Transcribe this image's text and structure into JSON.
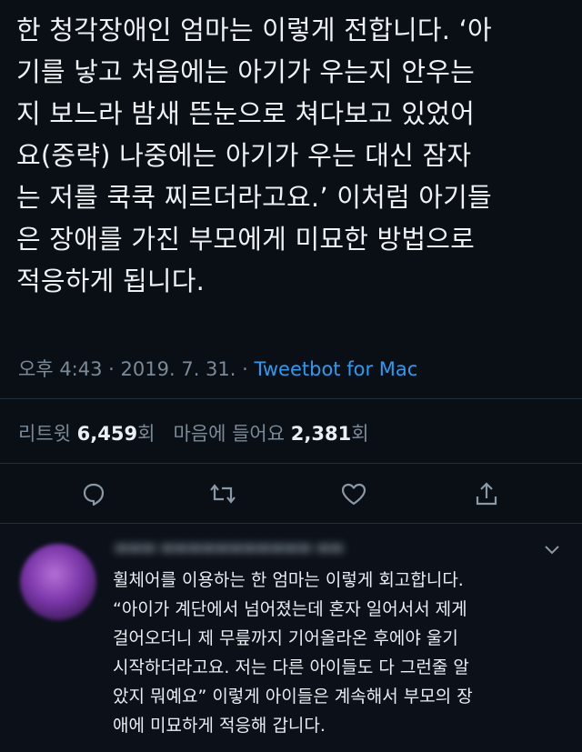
{
  "tweet": {
    "lines": [
      "한 청각장애인 엄마는 이렇게 전합니다. ‘아",
      "기를 낳고 처음에는 아기가 우는지 안우는",
      "지 보느라 밤새 뜬눈으로 쳐다보고 있었어",
      "요(중략) 나중에는 아기가 우는 대신 잠자",
      "는 저를 쿡쿡 찌르더라고요.’ 이처럼 아기들",
      "은 장애를 가진 부모에게 미묘한 방법으로",
      "적응하게 됩니다."
    ],
    "time": "오후 4:43",
    "date": "2019. 7. 31.",
    "separator": "·",
    "source": "Tweetbot for Mac"
  },
  "stats": {
    "retweet_label": "리트윗",
    "retweet_count": "6,459",
    "retweet_unit": "회",
    "like_label": "마음에 들어요",
    "like_count": "2,381",
    "like_unit": "회"
  },
  "actions": {
    "icons": [
      "reply-icon",
      "retweet-icon",
      "like-icon",
      "share-icon"
    ]
  },
  "reply": {
    "lines": [
      "휠체어를 이용하는 한 엄마는 이렇게 회고합니다.",
      "“아이가 계단에서 넘어졌는데 혼자 일어서서 제게",
      "걸어오더니 제 무릎까지 기어올라온 후에야 울기",
      "시작하더라고요. 저는 다른 아이들도 다 그런줄 알",
      "았지 뭐예요” 이렇게 아이들은 계속해서 부모의 장",
      "애에 미묘하게 적응해 갑니다."
    ]
  },
  "colors": {
    "background": "#0a0e15",
    "link": "#2b9bf0",
    "muted": "#7b8a99"
  }
}
